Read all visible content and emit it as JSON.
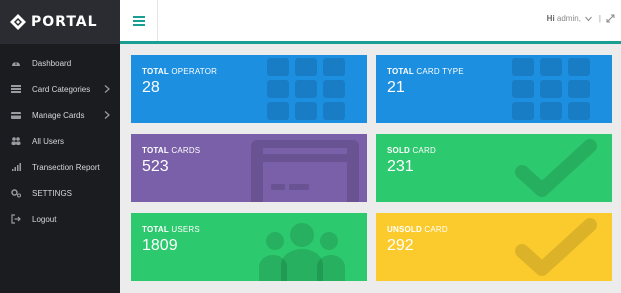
{
  "brand": {
    "name": "PORTAL"
  },
  "sidebar": {
    "items": [
      {
        "label": "Dashboard",
        "icon": "dashboard-icon",
        "has_submenu": false
      },
      {
        "label": "Card Categories",
        "icon": "list-icon",
        "has_submenu": true
      },
      {
        "label": "Manage Cards",
        "icon": "card-icon",
        "has_submenu": true
      },
      {
        "label": "All Users",
        "icon": "users-icon",
        "has_submenu": false
      },
      {
        "label": "Transection Report",
        "icon": "bar-chart-icon",
        "has_submenu": false
      },
      {
        "label": "SETTINGS",
        "icon": "gear-icon",
        "has_submenu": false
      },
      {
        "label": "Logout",
        "icon": "logout-icon",
        "has_submenu": false
      }
    ]
  },
  "topbar": {
    "greeting": "Hi",
    "username": "admin,",
    "separator": "|",
    "accent_color": "#1a9d92"
  },
  "cards": [
    {
      "bold": "TOTAL",
      "rest": " OPERATOR",
      "value": "28",
      "color": "#1d8fe1",
      "icon": "grid-icon"
    },
    {
      "bold": "TOTAL",
      "rest": " CARD TYPE",
      "value": "21",
      "color": "#1d8fe1",
      "icon": "grid-icon"
    },
    {
      "bold": "TOTAL",
      "rest": " CARDS",
      "value": "523",
      "color": "#7a60a8",
      "icon": "credit-card-icon"
    },
    {
      "bold": "SOLD",
      "rest": " CARD",
      "value": "231",
      "color": "#2cc96e",
      "icon": "check-icon"
    },
    {
      "bold": "TOTAL",
      "rest": " USERS",
      "value": "1809",
      "color": "#2cc96e",
      "icon": "users-icon"
    },
    {
      "bold": "UNSOLD",
      "rest": " CARD",
      "value": "292",
      "color": "#fbcb2e",
      "icon": "check-icon"
    }
  ]
}
